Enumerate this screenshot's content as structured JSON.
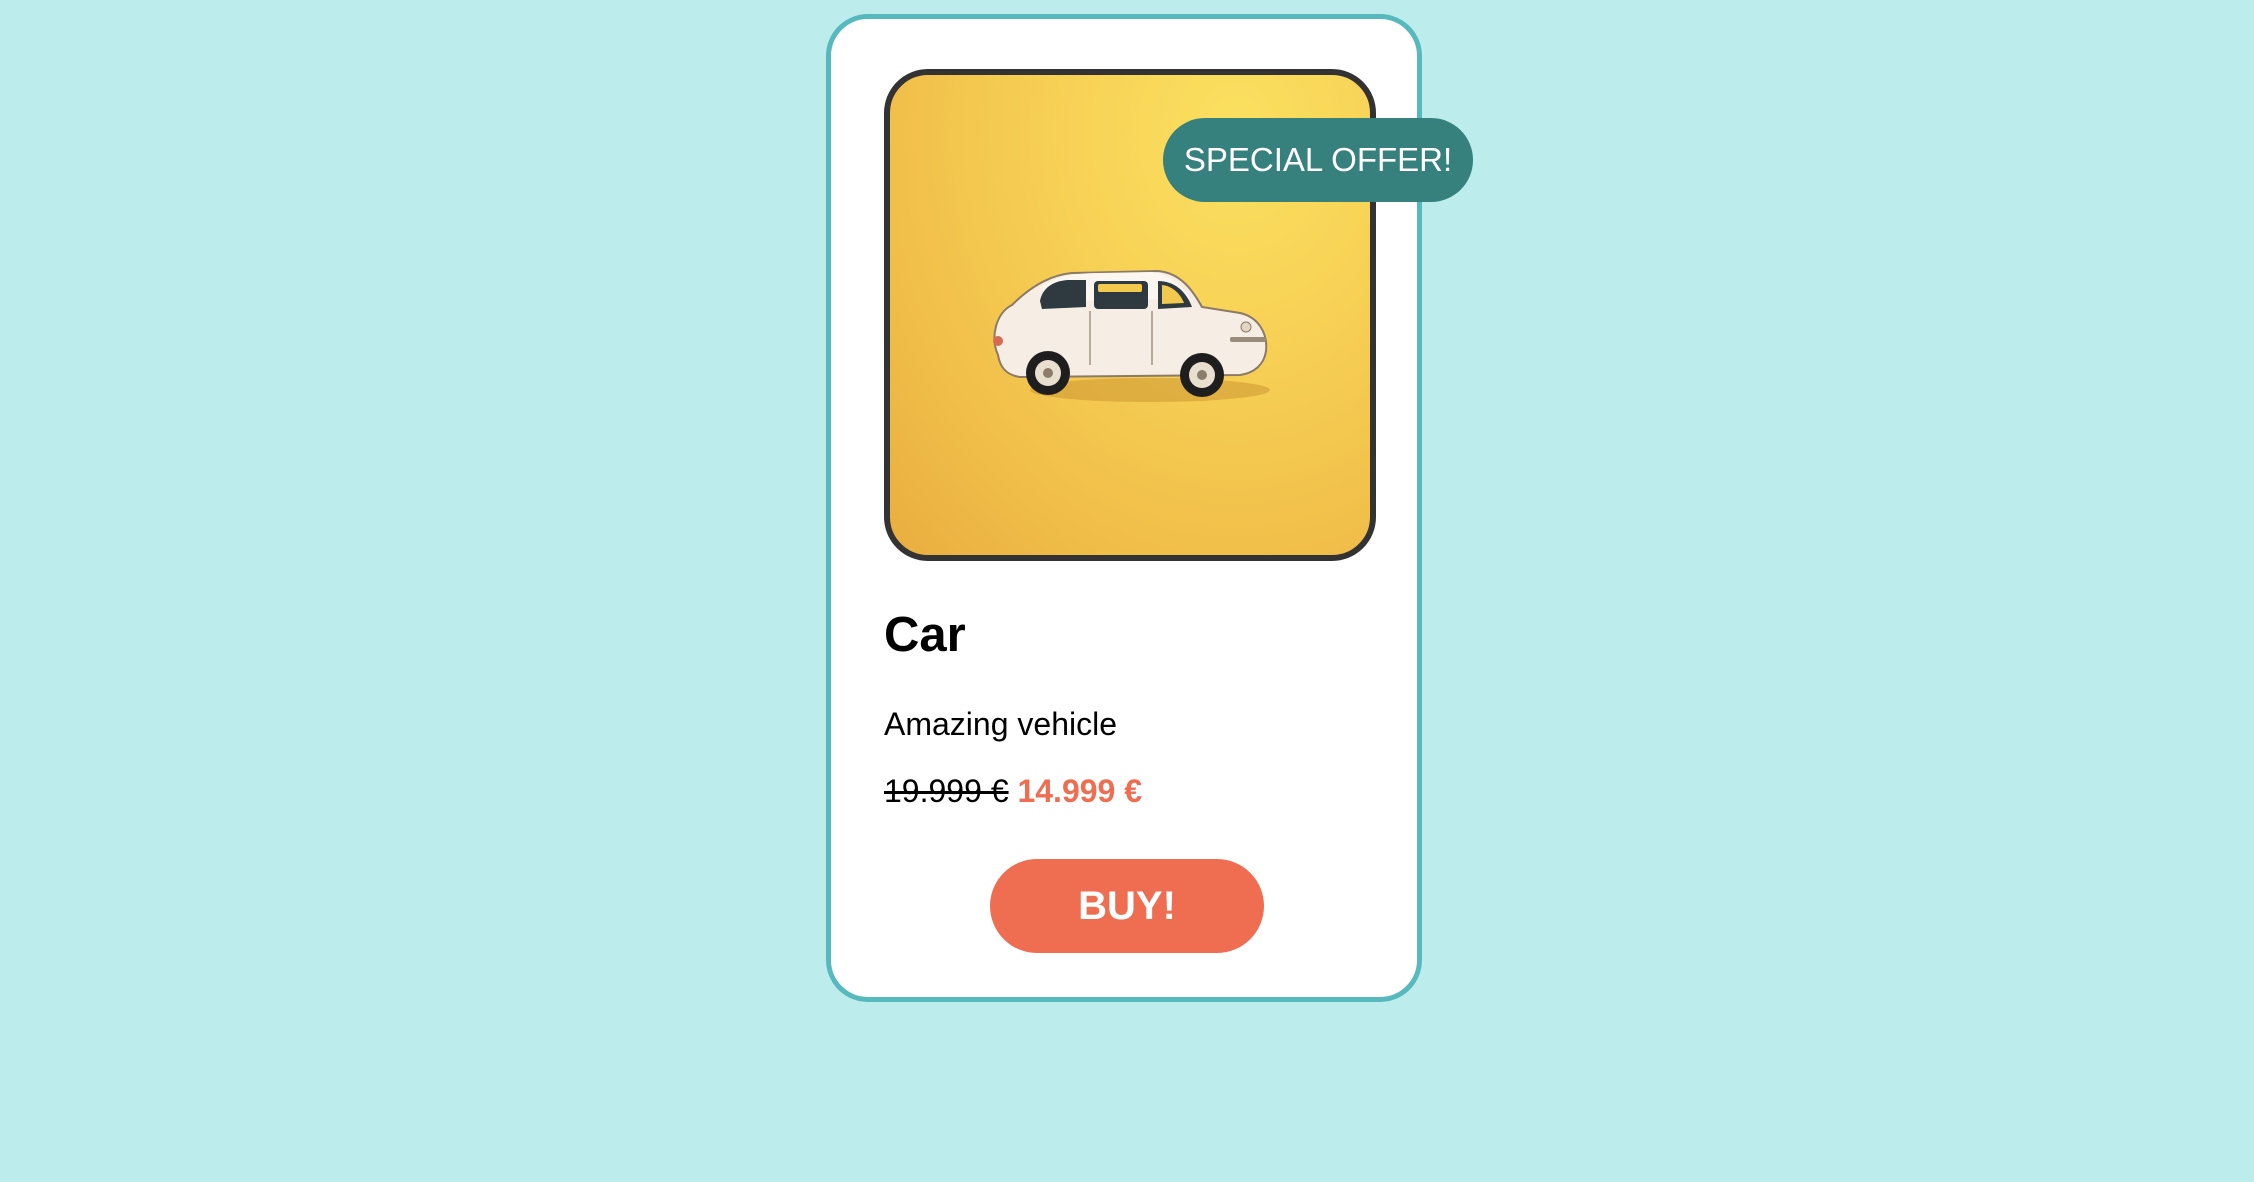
{
  "product": {
    "badge": "SPECIAL OFFER!",
    "title": "Car",
    "description": "Amazing vehicle",
    "old_price": "19.999 €",
    "new_price": "14.999 €",
    "buy_label": "BUY!",
    "image_icon": "car-icon"
  },
  "colors": {
    "background": "#bdecec",
    "card_border": "#56b9bd",
    "badge": "#36807e",
    "accent": "#ef6e52",
    "image_background": "#f5c94f"
  }
}
